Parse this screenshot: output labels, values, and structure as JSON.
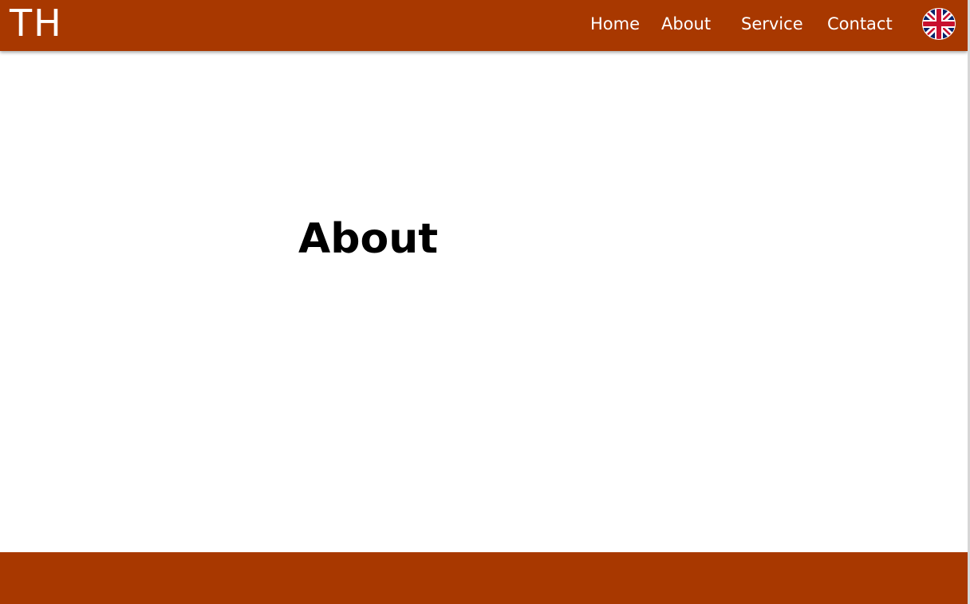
{
  "header": {
    "logo": "TH",
    "background_color": "#a83800"
  },
  "nav": {
    "home": "Home",
    "about": "About",
    "service": "Service",
    "contact": "Contact",
    "language_icon": "uk-flag-icon"
  },
  "main": {
    "title": "About"
  },
  "footer": {
    "background_color": "#a83800"
  }
}
